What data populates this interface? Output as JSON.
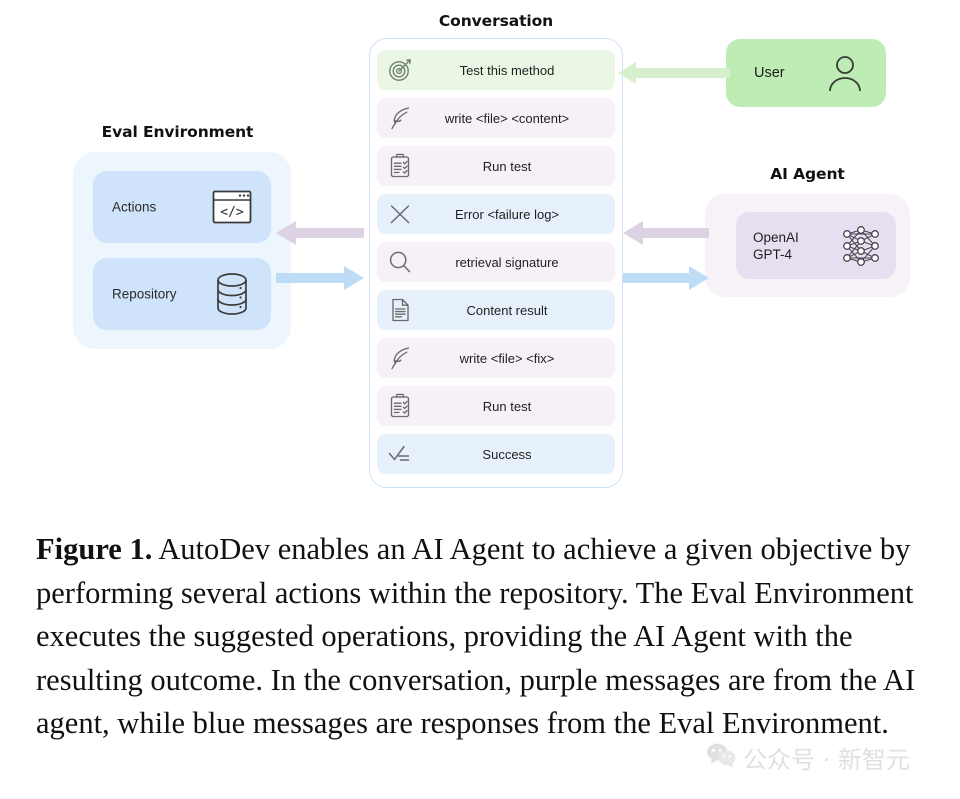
{
  "eval_environment": {
    "title": "Eval Environment",
    "cards": [
      {
        "label": "Actions",
        "icon": "code-window-icon"
      },
      {
        "label": "Repository",
        "icon": "database-icon"
      }
    ]
  },
  "conversation": {
    "title": "Conversation",
    "messages": [
      {
        "text": "Test this method",
        "icon": "target-icon",
        "tone": "green"
      },
      {
        "text": "write <file> <content>",
        "icon": "quill-icon",
        "tone": "purple"
      },
      {
        "text": "Run test",
        "icon": "clipboard-icon",
        "tone": "purple"
      },
      {
        "text": "Error <failure log>",
        "icon": "close-x-icon",
        "tone": "blue"
      },
      {
        "text": "retrieval signature",
        "icon": "search-icon",
        "tone": "purple"
      },
      {
        "text": "Content result",
        "icon": "document-icon",
        "tone": "blue"
      },
      {
        "text": "write <file> <fix>",
        "icon": "quill-icon",
        "tone": "purple"
      },
      {
        "text": "Run test",
        "icon": "clipboard-icon",
        "tone": "purple"
      },
      {
        "text": "Success",
        "icon": "checklist-icon",
        "tone": "blue"
      }
    ]
  },
  "user": {
    "label": "User",
    "icon": "person-icon"
  },
  "ai_agent": {
    "title": "AI Agent",
    "model_label": "OpenAI\nGPT-4",
    "icon": "neural-network-icon"
  },
  "arrows": [
    {
      "name": "user-to-conversation",
      "direction": "left",
      "color": "#d6f0cd"
    },
    {
      "name": "agent-to-conversation",
      "direction": "left",
      "color": "#ddd2e4"
    },
    {
      "name": "conversation-to-agent",
      "direction": "right",
      "color": "#bfdcf7"
    },
    {
      "name": "conversation-to-eval",
      "direction": "left",
      "color": "#ddd2e4"
    },
    {
      "name": "eval-to-conversation",
      "direction": "right",
      "color": "#bfdcf7"
    }
  ],
  "caption": {
    "label": "Figure 1.",
    "body": " AutoDev enables an AI Agent to achieve a given objective by performing several actions within the repository. The Eval Environment executes the suggested operations, providing the AI Agent with the resulting outcome. In the conversation, purple messages are from the AI agent, while blue messages are responses from the Eval Environment."
  },
  "watermark": {
    "text": "公众号 · 新智元",
    "icon": "wechat-icon"
  },
  "colors": {
    "green_message": "#e9f7e4",
    "purple_message": "#f5f1f7",
    "blue_message": "#e7f1fb",
    "user_box": "#bdedb4",
    "agent_card": "#e7dff0",
    "eval_card": "#cfe4fa",
    "eval_outer": "#eef6fd",
    "conversation_border": "#cfe2f5"
  }
}
